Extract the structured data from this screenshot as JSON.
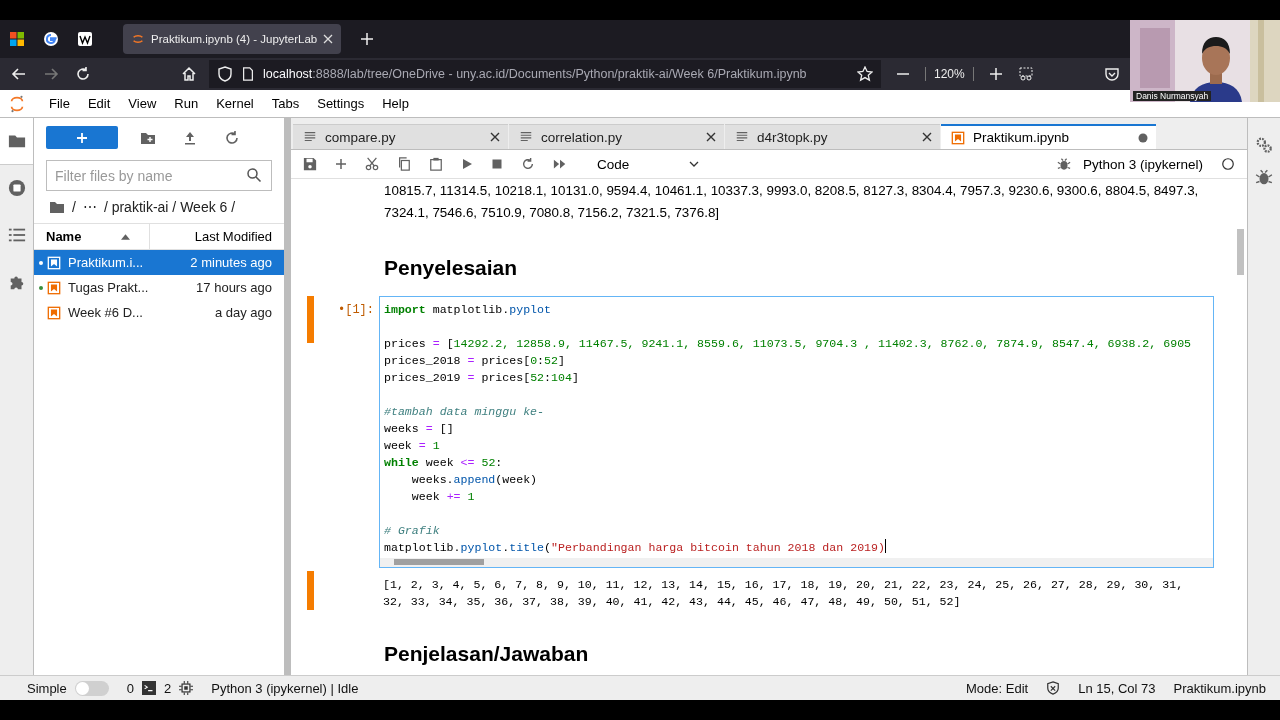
{
  "browser": {
    "tab": {
      "title": "Praktikum.ipynb (4) - JupyterLab",
      "selected": true
    },
    "address": {
      "host": "localhost",
      "path": ":8888/lab/tree/OneDrive - uny.ac.id/Documents/Python/praktik-ai/Week 6/Praktikum.ipynb"
    },
    "zoom": "120%"
  },
  "webcam": {
    "kind": "picture",
    "name": "Danis Nurmansyah"
  },
  "menu": [
    "File",
    "Edit",
    "View",
    "Run",
    "Kernel",
    "Tabs",
    "Settings",
    "Help"
  ],
  "activity_bar": [
    {
      "selected": true
    },
    {
      "selected": false
    },
    {
      "selected": false
    },
    {
      "selected": false
    }
  ],
  "file_browser": {
    "filter_placeholder": "Filter files by name",
    "breadcrumbs": [
      "/",
      "⋯",
      "/ praktik-ai / Week 6 /"
    ],
    "columns": [
      "Name",
      "Last Modified"
    ],
    "files": [
      {
        "name": "Praktikum.i...",
        "modified": "2 minutes ago",
        "selected": true,
        "running": true
      },
      {
        "name": "Tugas Prakt...",
        "modified": "17 hours ago",
        "selected": false,
        "running": true
      },
      {
        "name": "Week #6 D...",
        "modified": "a day ago",
        "selected": false,
        "running": false
      }
    ]
  },
  "doc_tabs": [
    {
      "label": "compare.py",
      "kind": "file",
      "selected": false,
      "dirty": false
    },
    {
      "label": "correlation.py",
      "kind": "file",
      "selected": false,
      "dirty": false
    },
    {
      "label": "d4r3topk.py",
      "kind": "file",
      "selected": false,
      "dirty": false
    },
    {
      "label": "Praktikum.ipynb",
      "kind": "notebook",
      "selected": true,
      "dirty": true
    }
  ],
  "toolbar": {
    "cell_type": "Code",
    "kernel": "Python 3 (ipykernel)"
  },
  "notebook": {
    "prev_output": [
      "10815.7, 11314.5, 10218.1, 10131.0, 9594.4, 10461.1, 10337.3, 9993.0, 8208.5, 8127.3, 8304.4, 7957.3, 9230.6, 9300.6, 8804.5, 8497.3,",
      "7324.1, 7546.6, 7510.9, 7080.8, 7156.2, 7321.5, 7376.8]"
    ],
    "heading": "Penyelesaian",
    "cell": {
      "prompt": "•[1]:",
      "active": true,
      "lines": [
        {
          "kind": "code",
          "tokens": [
            {
              "kind": "kw",
              "text": "import"
            },
            {
              "kind": "plain",
              "text": " matplotlib."
            },
            {
              "kind": "attr",
              "text": "pyplot"
            }
          ]
        },
        {
          "kind": "blank"
        },
        {
          "kind": "code",
          "tokens": [
            {
              "kind": "plain",
              "text": "prices "
            },
            {
              "kind": "op",
              "text": "="
            },
            {
              "kind": "plain",
              "text": " ["
            },
            {
              "kind": "num",
              "text": "14292.2, 12858.9, 11467.5, 9241.1, 8559.6, 11073.5, 9704.3 , 11402.3, 8762.0, 7874.9, 8547.4, 6938.2, 6905"
            }
          ]
        },
        {
          "kind": "code",
          "tokens": [
            {
              "kind": "plain",
              "text": "prices_2018 "
            },
            {
              "kind": "op",
              "text": "="
            },
            {
              "kind": "plain",
              "text": " prices["
            },
            {
              "kind": "num",
              "text": "0"
            },
            {
              "kind": "plain",
              "text": ":"
            },
            {
              "kind": "num",
              "text": "52"
            },
            {
              "kind": "plain",
              "text": "]"
            }
          ]
        },
        {
          "kind": "code",
          "tokens": [
            {
              "kind": "plain",
              "text": "prices_2019 "
            },
            {
              "kind": "op",
              "text": "="
            },
            {
              "kind": "plain",
              "text": " prices["
            },
            {
              "kind": "num",
              "text": "52"
            },
            {
              "kind": "plain",
              "text": ":"
            },
            {
              "kind": "num",
              "text": "104"
            },
            {
              "kind": "plain",
              "text": "]"
            }
          ]
        },
        {
          "kind": "blank"
        },
        {
          "kind": "code",
          "tokens": [
            {
              "kind": "comment",
              "text": "#tambah data minggu ke-"
            }
          ]
        },
        {
          "kind": "code",
          "tokens": [
            {
              "kind": "plain",
              "text": "weeks "
            },
            {
              "kind": "op",
              "text": "="
            },
            {
              "kind": "plain",
              "text": " []"
            }
          ]
        },
        {
          "kind": "code",
          "tokens": [
            {
              "kind": "plain",
              "text": "week "
            },
            {
              "kind": "op",
              "text": "= "
            },
            {
              "kind": "num",
              "text": "1"
            }
          ]
        },
        {
          "kind": "code",
          "tokens": [
            {
              "kind": "kw",
              "text": "while"
            },
            {
              "kind": "plain",
              "text": " week "
            },
            {
              "kind": "op",
              "text": "<= "
            },
            {
              "kind": "num",
              "text": "52"
            },
            {
              "kind": "plain",
              "text": ":"
            }
          ]
        },
        {
          "kind": "code",
          "tokens": [
            {
              "kind": "plain",
              "text": "    weeks."
            },
            {
              "kind": "attr",
              "text": "append"
            },
            {
              "kind": "plain",
              "text": "(week)"
            }
          ]
        },
        {
          "kind": "code",
          "tokens": [
            {
              "kind": "plain",
              "text": "    week "
            },
            {
              "kind": "op",
              "text": "+= "
            },
            {
              "kind": "num",
              "text": "1"
            }
          ]
        },
        {
          "kind": "blank"
        },
        {
          "kind": "code",
          "tokens": [
            {
              "kind": "comment",
              "text": "# Grafik"
            }
          ]
        },
        {
          "kind": "code",
          "caret": true,
          "tokens": [
            {
              "kind": "plain",
              "text": "matplotlib."
            },
            {
              "kind": "attr",
              "text": "pyplot"
            },
            {
              "kind": "plain",
              "text": "."
            },
            {
              "kind": "attr",
              "text": "title"
            },
            {
              "kind": "plain",
              "text": "("
            },
            {
              "kind": "str",
              "text": "\"Perbandingan harga bitcoin tahun 2018 dan 2019)"
            }
          ]
        }
      ],
      "output": [
        "[1, 2, 3, 4, 5, 6, 7, 8, 9, 10, 11, 12, 13, 14, 15, 16, 17, 18, 19, 20, 21, 22, 23, 24, 25, 26, 27, 28, 29, 30, 31,",
        "32, 33, 34, 35, 36, 37, 38, 39, 40, 41, 42, 43, 44, 45, 46, 47, 48, 49, 50, 51, 52]"
      ]
    },
    "heading_2": "Penjelasan/Jawaban"
  },
  "status_bar": {
    "simple_label": "Simple",
    "simple_on": false,
    "terminals": "0",
    "kernels": "2",
    "kernel_status": "Python 3 (ipykernel) | Idle",
    "mode": "Mode: Edit",
    "position": "Ln 15, Col 73",
    "file": "Praktikum.ipynb"
  }
}
